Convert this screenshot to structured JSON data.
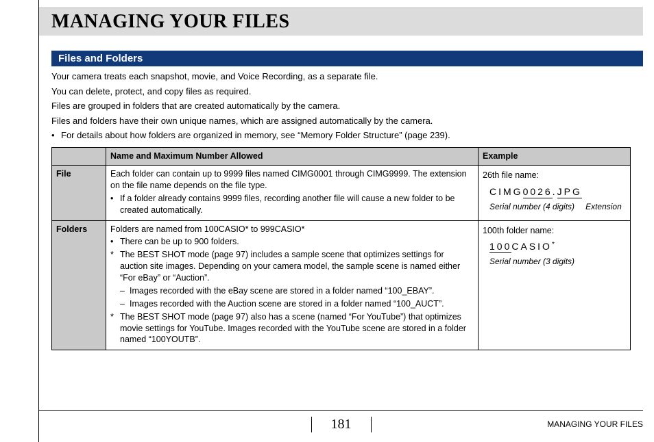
{
  "page_title": "MANAGING YOUR FILES",
  "section_title": "Files and Folders",
  "intro": {
    "p1": "Your camera treats each snapshot, movie, and Voice Recording, as a separate file.",
    "p2": "You can delete, protect, and copy files as required.",
    "p3": "Files are grouped in folders that are created automatically by the camera.",
    "p4": "Files and folders have their own unique names, which are assigned automatically by the camera.",
    "bullet": "For details about how folders are organized in memory, see “Memory Folder Structure” (page 239)."
  },
  "table": {
    "header_blank": "",
    "header_name": "Name and Maximum Number Allowed",
    "header_example": "Example",
    "file": {
      "label": "File",
      "desc": "Each folder can contain up to 9999 files named CIMG0001 through CIMG9999. The extension on the file name depends on the file type.",
      "bullet": "If a folder already contains 9999 files, recording another file will cause a new folder to be created automatically.",
      "example_lead": "26th file name:",
      "filename_part1": "CIMG",
      "filename_serial": "0026",
      "filename_dot": ".",
      "filename_ext": "JPG",
      "anno_serial": "Serial number (4 digits)",
      "anno_ext": "Extension"
    },
    "folders": {
      "label": "Folders",
      "desc": "Folders are named from 100CASIO* to 999CASIO*",
      "bullet": "There can be up to 900 folders.",
      "ast1": "The BEST SHOT mode (page 97) includes a sample scene that optimizes settings for auction site images. Depending on your camera model, the sample scene is named either “For eBay” or “Auction”.",
      "dash1": "Images recorded with the eBay scene are stored in a folder named “100_EBAY”.",
      "dash2": "Images recorded with the Auction scene are stored in a folder named “100_AUCT”.",
      "ast2": "The BEST SHOT mode (page 97) also has a scene (named “For YouTube”) that optimizes movie settings for YouTube. Images recorded with the YouTube scene are stored in a folder named “100YOUTB”.",
      "example_lead": "100th folder name:",
      "foldername_serial": "100",
      "foldername_rest": "CASIO",
      "foldername_ast": "*",
      "anno_serial": "Serial number (3 digits)"
    }
  },
  "footer": {
    "page_number": "181",
    "running_head": "MANAGING YOUR FILES"
  }
}
